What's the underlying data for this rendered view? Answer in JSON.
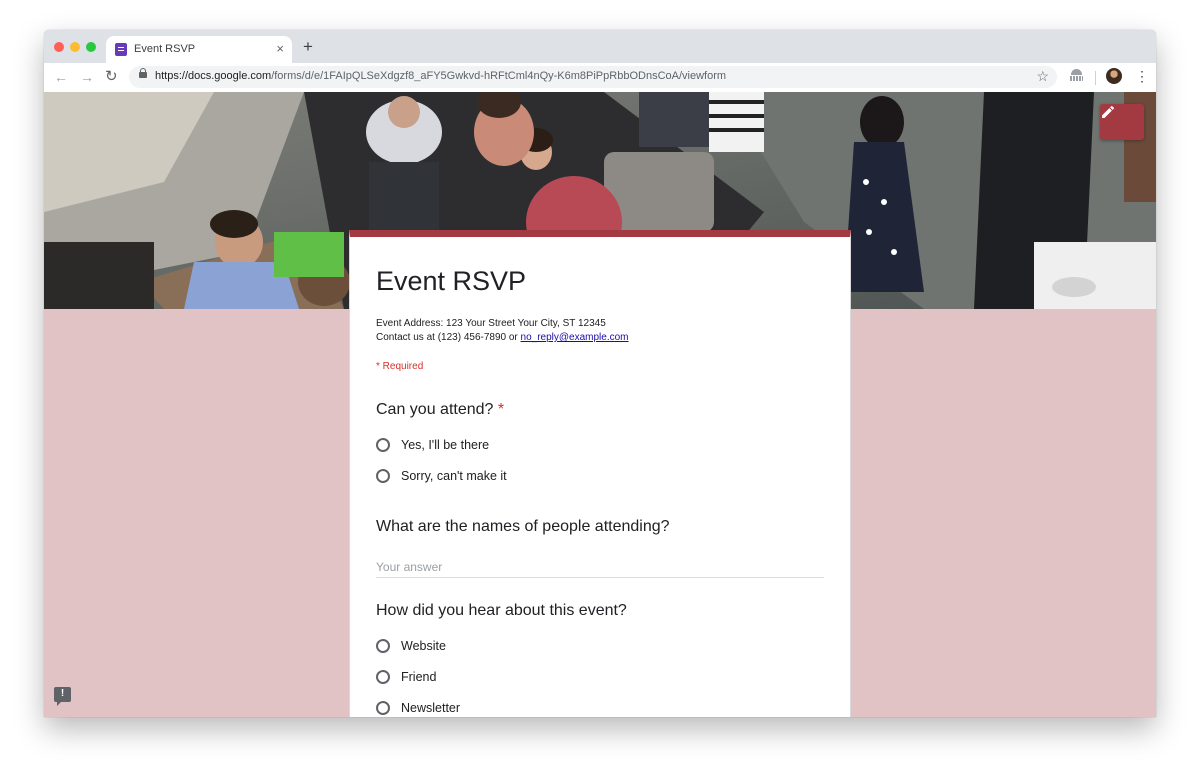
{
  "browser": {
    "tab_title": "Event RSVP",
    "tab_close": "×",
    "new_tab": "+",
    "url_host": "https://docs.google.com",
    "url_path": "/forms/d/e/1FAIpQLSeXdgzf8_aFY5Gwkvd-hRFtCml4nQy-K6m8PiPpRbbODnsCoA/viewform",
    "back": "←",
    "forward": "→",
    "reload": "↻",
    "star": "☆",
    "menu": "⋮"
  },
  "form": {
    "title": "Event RSVP",
    "address_line": "Event Address: 123 Your Street Your City, ST 12345",
    "contact_prefix": "Contact us at (123) 456-7890 or ",
    "contact_email": "no_reply@example.com",
    "required_note": "* Required",
    "questions": [
      {
        "title": "Can you attend?",
        "required_mark": "*",
        "options": [
          "Yes, I'll be there",
          "Sorry, can't make it"
        ]
      },
      {
        "title": "What are the names of people attending?",
        "placeholder": "Your answer",
        "value": ""
      },
      {
        "title": "How did you hear about this event?",
        "options": [
          "Website",
          "Friend",
          "Newsletter"
        ]
      }
    ]
  },
  "colors": {
    "accent": "#a33a42",
    "background": "#e1c3c6"
  },
  "icons": {
    "edit": "pencil-icon",
    "feedback": "feedback-icon"
  }
}
